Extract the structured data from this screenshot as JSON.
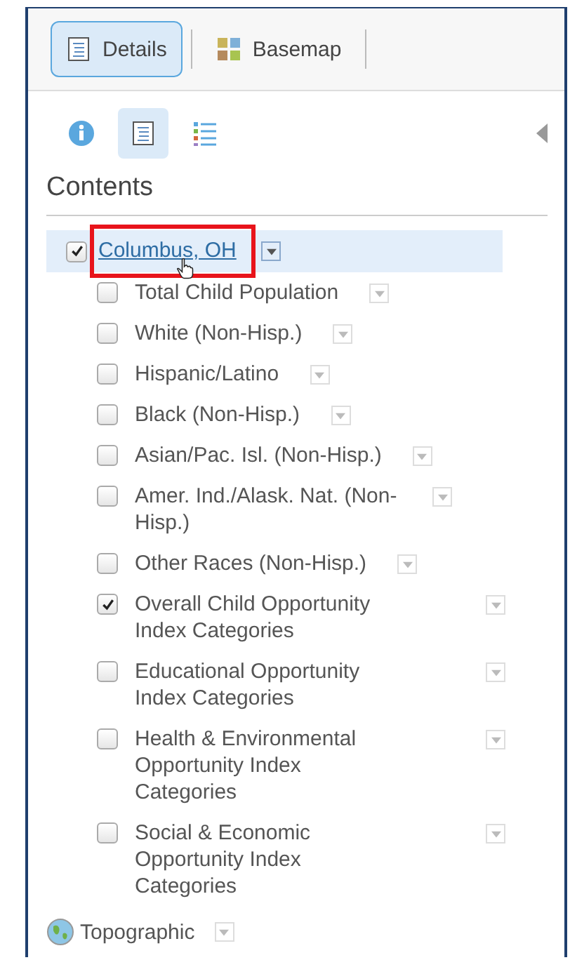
{
  "tabs": [
    {
      "label": "Details",
      "kind": "details",
      "selected": true
    },
    {
      "label": "Basemap",
      "kind": "basemap",
      "selected": false
    }
  ],
  "panel_buttons": [
    {
      "kind": "info",
      "selected": false
    },
    {
      "kind": "content",
      "selected": true
    },
    {
      "kind": "legend",
      "selected": false
    }
  ],
  "section_title": "Contents",
  "layer": {
    "name": "Columbus, OH",
    "checked": true,
    "selected": true,
    "annotated": true,
    "children": [
      {
        "name": "Total Child Population",
        "checked": false
      },
      {
        "name": "White (Non-Hisp.)",
        "checked": false
      },
      {
        "name": "Hispanic/Latino",
        "checked": false
      },
      {
        "name": "Black (Non-Hisp.)",
        "checked": false
      },
      {
        "name": "Asian/Pac. Isl. (Non-Hisp.)",
        "checked": false
      },
      {
        "name": "Amer. Ind./Alask. Nat. (Non-Hisp.)",
        "checked": false
      },
      {
        "name": "Other Races (Non-Hisp.)",
        "checked": false
      },
      {
        "name": "Overall Child Opportunity Index Categories",
        "checked": true
      },
      {
        "name": "Educational Opportunity Index Categories",
        "checked": false
      },
      {
        "name": "Health & Environmental Opportunity Index Categories",
        "checked": false
      },
      {
        "name": "Social & Economic Opportunity Index Categories",
        "checked": false
      }
    ]
  },
  "basemap": {
    "name": "Topographic"
  }
}
